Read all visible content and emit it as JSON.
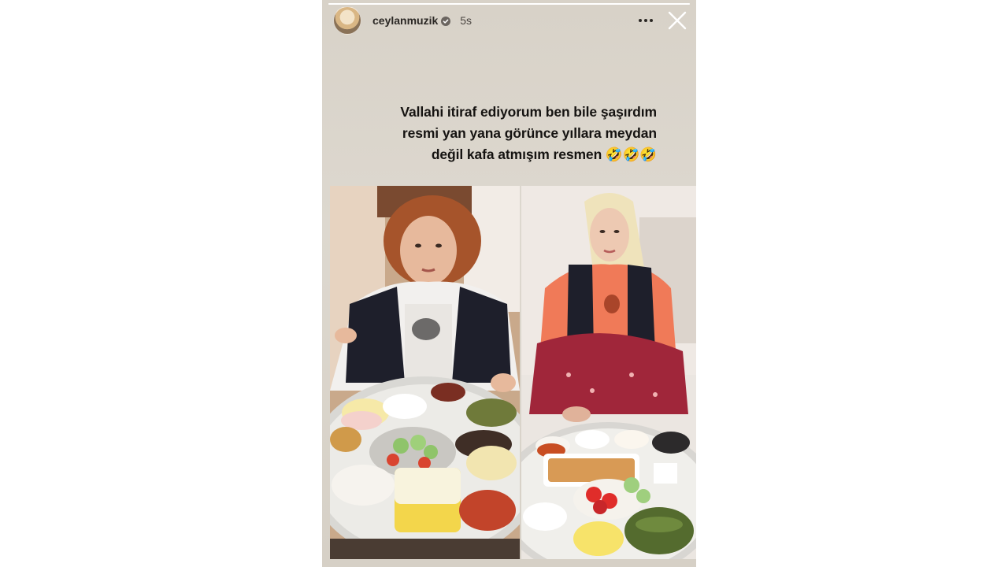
{
  "story": {
    "username": "ceylanmuzik",
    "time_ago": "5s",
    "caption_lines": [
      "Vallahi itiraf ediyorum ben bile şaşırdım",
      "resmi yan yana  görünce yıllara  meydan",
      "değil kafa atmışım resmen 🤣🤣🤣"
    ],
    "progress": 1.0
  },
  "icons": {
    "avatar": "profile-avatar",
    "verified": "verified-badge-icon",
    "more": "more-options-icon",
    "close": "close-icon"
  },
  "colors": {
    "story_background": "#dbd5cc",
    "caption_text": "#151311",
    "verified_badge": "#3897f0"
  }
}
